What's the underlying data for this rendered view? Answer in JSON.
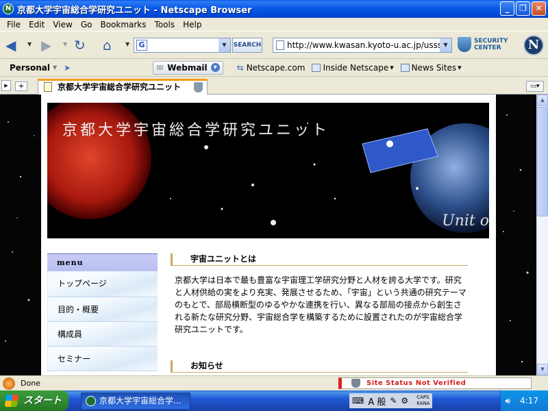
{
  "window": {
    "title": "京都大学宇宙総合学研究ユニット - Netscape Browser"
  },
  "menubar": {
    "items": [
      "File",
      "Edit",
      "View",
      "Go",
      "Bookmarks",
      "Tools",
      "Help"
    ]
  },
  "toolbar": {
    "search_button": "SEARCH",
    "url": "http://www.kwasan.kyoto-u.ac.jp/usss/",
    "security_line1": "SECURITY",
    "security_line2": "CENTER",
    "logo_letter": "N"
  },
  "personal_toolbar": {
    "personal": "Personal",
    "webmail": "Webmail",
    "links": [
      "Netscape.com",
      "Inside Netscape",
      "News Sites"
    ]
  },
  "tab": {
    "title": "京都大学宇宙総合学研究ユニット"
  },
  "page": {
    "banner_title": "京都大学宇宙総合学研究ユニット",
    "banner_subtitle": "Unit o",
    "menu_header": "menu",
    "menu_items": [
      "トップページ",
      "目的・概要",
      "構成員",
      "セミナー"
    ],
    "section1_title": "宇宙ユニットとは",
    "section1_body": "京都大学は日本で最も豊富な宇宙理工学研究分野と人材を誇る大学です。研究と人材供給の実をより充実、発展させるため、「宇宙」という共通の研究テーマのもとで、部局横断型のゆるやかな連携を行い、異なる部局の接点から創生される新たな研究分野、宇宙総合学を構築するために設置されたのが宇宙総合学研究ユニットです。",
    "section2_title": "お知らせ"
  },
  "statusbar": {
    "status": "Done",
    "site_status": "Site Status Not Verified"
  },
  "taskbar": {
    "start": "スタート",
    "task_item": "京都大学宇宙総合学...",
    "ime_mode": "A 般",
    "caps": "CAPS",
    "kana": "KANA",
    "clock": "4:17"
  },
  "colors": {
    "title_bar": "#0A5AE8",
    "tab_accent": "#f39c1d",
    "menu_header_bg": "#c8ccf4",
    "site_status_text": "#d61d1d",
    "start_green": "#2f8a2f"
  }
}
